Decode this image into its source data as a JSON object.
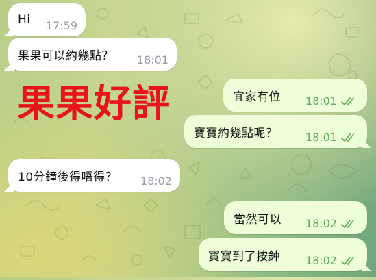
{
  "colors": {
    "incoming_bubble": "#ffffff",
    "outgoing_bubble": "#eefed9",
    "outgoing_time": "#5fae57",
    "incoming_time": "#9aa0a6",
    "read_checks": "#5fae57",
    "overlay_title": "#e8141a"
  },
  "overlay": {
    "title": "果果好評"
  },
  "messages": [
    {
      "direction": "incoming",
      "text": "Hi",
      "time": "17:59"
    },
    {
      "direction": "incoming",
      "text": "果果可以約幾點？",
      "time": "18:01"
    },
    {
      "direction": "outgoing",
      "text": "宜家有位",
      "time": "18:01",
      "status_icon": "double-check-icon"
    },
    {
      "direction": "outgoing",
      "text": "寶寶約幾點呢？",
      "time": "18:01",
      "status_icon": "double-check-icon"
    },
    {
      "direction": "incoming",
      "text": "10分鐘後得唔得？",
      "time": "18:02"
    },
    {
      "direction": "outgoing",
      "text": "當然可以",
      "time": "18:02",
      "status_icon": "double-check-icon"
    },
    {
      "direction": "outgoing",
      "text": "寶寶到了按鈡",
      "time": "18:02",
      "status_icon": "double-check-icon"
    }
  ]
}
